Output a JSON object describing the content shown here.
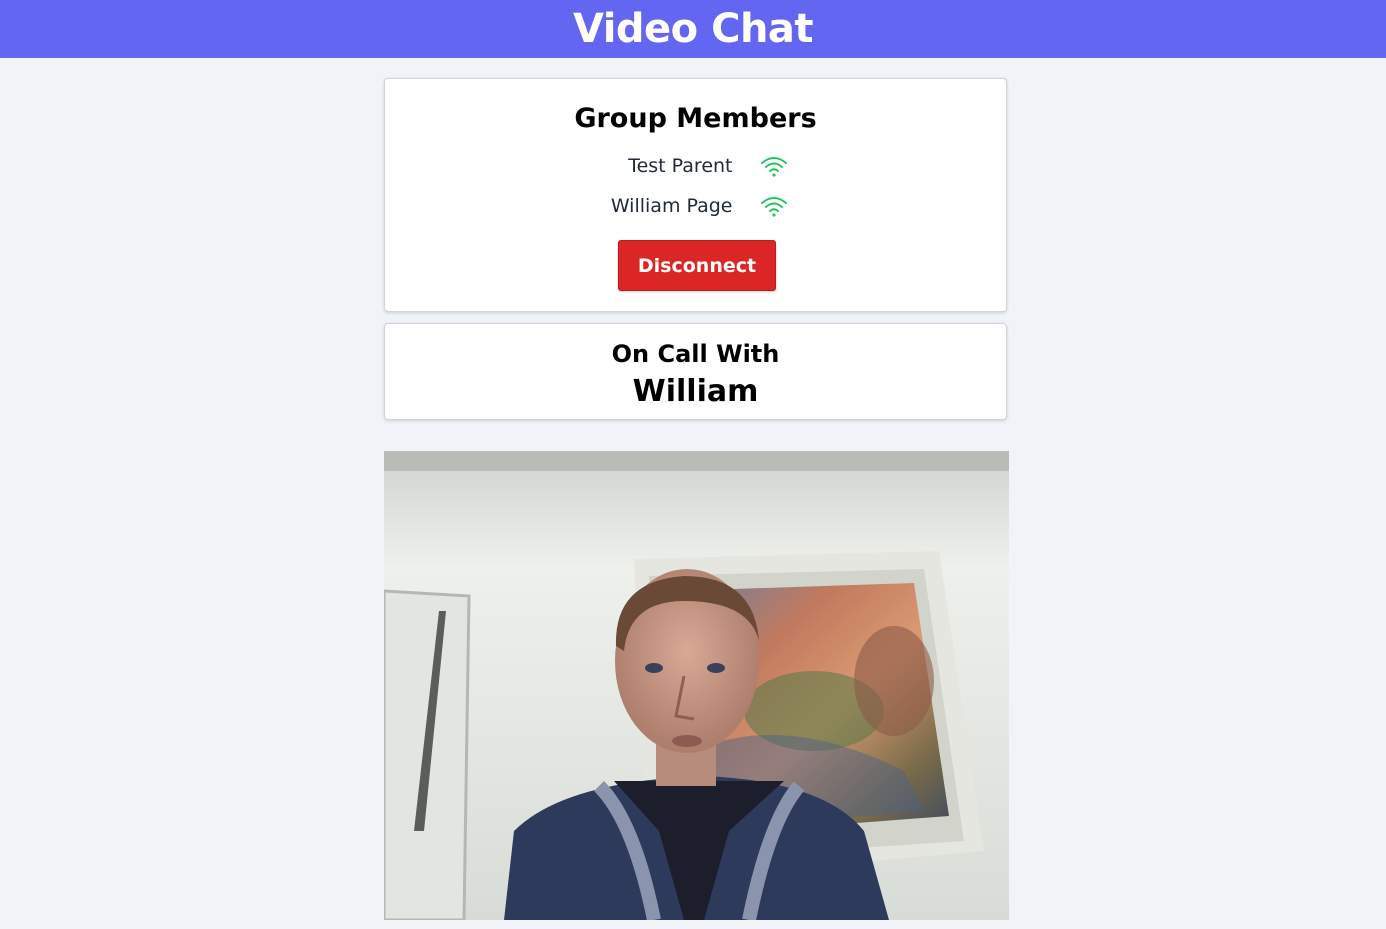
{
  "header": {
    "title": "Video Chat",
    "background": "#6366f1"
  },
  "group_members": {
    "title": "Group Members",
    "members": [
      {
        "name": "Test Parent",
        "status_icon": "wifi-icon",
        "status_color": "#22c55e"
      },
      {
        "name": "William Page",
        "status_icon": "wifi-icon",
        "status_color": "#22c55e"
      }
    ],
    "disconnect_label": "Disconnect",
    "disconnect_color": "#dc2626"
  },
  "call": {
    "label": "On Call With",
    "name": "William"
  },
  "video": {
    "description_icon": "video-feed"
  }
}
